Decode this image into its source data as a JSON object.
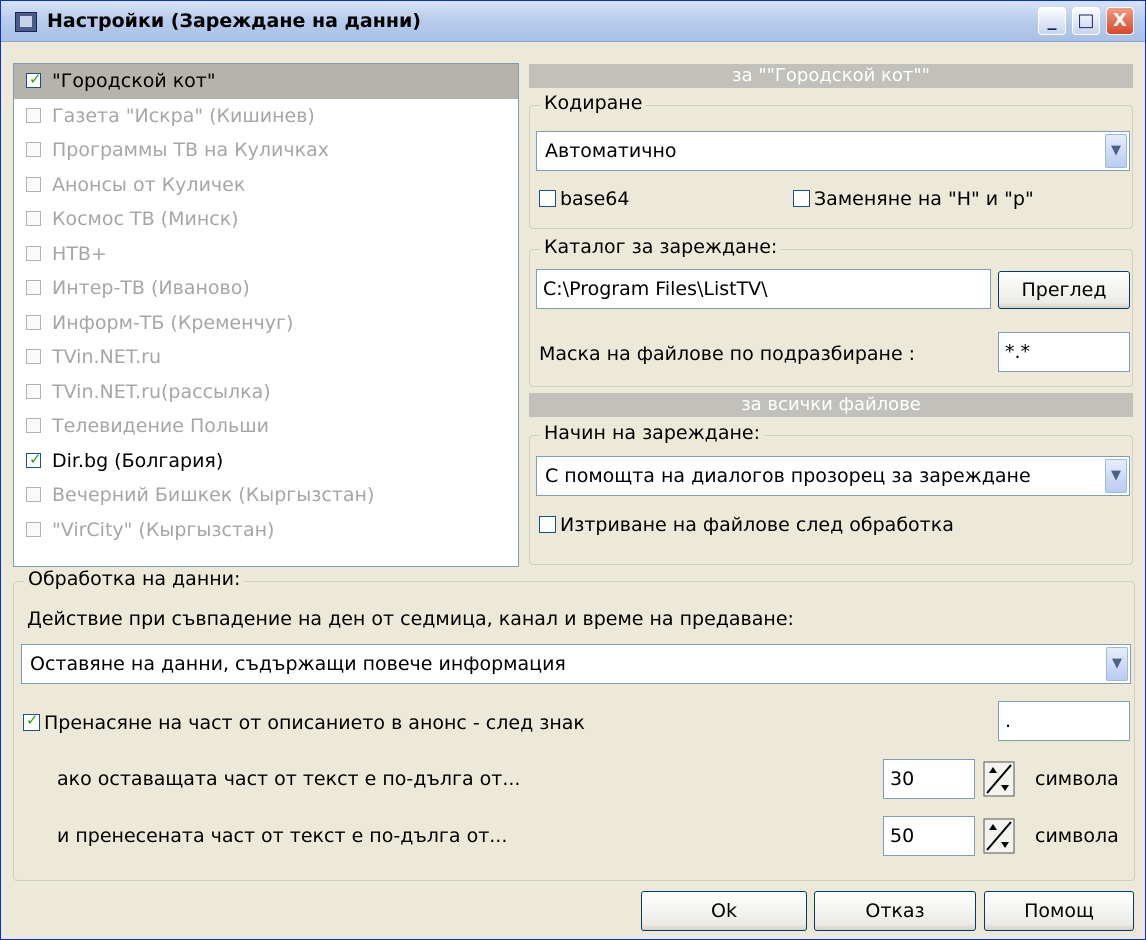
{
  "window": {
    "title": "Настройки (Зареждане на данни)",
    "minimize": "_",
    "maximize": "□",
    "close": "X"
  },
  "sources": [
    {
      "label": "\"Городской кот\"",
      "checked": true,
      "selected": true
    },
    {
      "label": "Газета \"Искра\" (Кишинев)",
      "checked": false
    },
    {
      "label": "Программы ТВ на Куличках",
      "checked": false
    },
    {
      "label": "Анонсы от Куличек",
      "checked": false
    },
    {
      "label": "Космос ТВ (Минск)",
      "checked": false
    },
    {
      "label": "НТВ+",
      "checked": false
    },
    {
      "label": "Интер-ТВ (Иваново)",
      "checked": false
    },
    {
      "label": "Информ-ТБ (Кременчуг)",
      "checked": false
    },
    {
      "label": "TVin.NET.ru",
      "checked": false
    },
    {
      "label": "TVin.NET.ru(рассылка)",
      "checked": false
    },
    {
      "label": "Телевидение Польши",
      "checked": false
    },
    {
      "label": "Dir.bg (Болгария)",
      "checked": true
    },
    {
      "label": "Вечерний Бишкек (Кыргызстан)",
      "checked": false
    },
    {
      "label": "\"VirCity\" (Кыргызстан)",
      "checked": false
    }
  ],
  "source_settings": {
    "header": "за \"\"Городской кот\"\"",
    "encoding_legend": "Кодиране",
    "encoding_value": "Автоматично",
    "base64_label": "base64",
    "replace_label": "Заменяне на \"Н\" и \"р\"",
    "folder_legend": "Каталог за зареждане:",
    "folder_value": "C:\\Program Files\\ListTV\\",
    "browse_label": "Преглед",
    "mask_label": "Маска на файлове по подразбиране :",
    "mask_value": "*.*"
  },
  "all_files": {
    "header": "за всички файлове",
    "mode_legend": "Начин на зареждане:",
    "mode_value": "С помощта на диалогов прозорец за зареждане",
    "delete_label": "Изтриване на файлове след обработка"
  },
  "processing": {
    "legend": "Обработка на данни:",
    "conflict_label": "Действие при съвпадение на ден от седмица, канал и време на предаване:",
    "conflict_value": "Оставяне на данни, съдържащи повече информация",
    "transfer_label": "Пренасяне на част от описанието в анонс - след знак",
    "transfer_char": ".",
    "remaining_label": "ако оставащата част от текст е по-дълга от...",
    "remaining_value": "30",
    "transferred_label": "и пренесената част от текст е по-дълга от...",
    "transferred_value": "50",
    "unit": "символа"
  },
  "buttons": {
    "ok": "Ok",
    "cancel": "Отказ",
    "help": "Помощ"
  }
}
